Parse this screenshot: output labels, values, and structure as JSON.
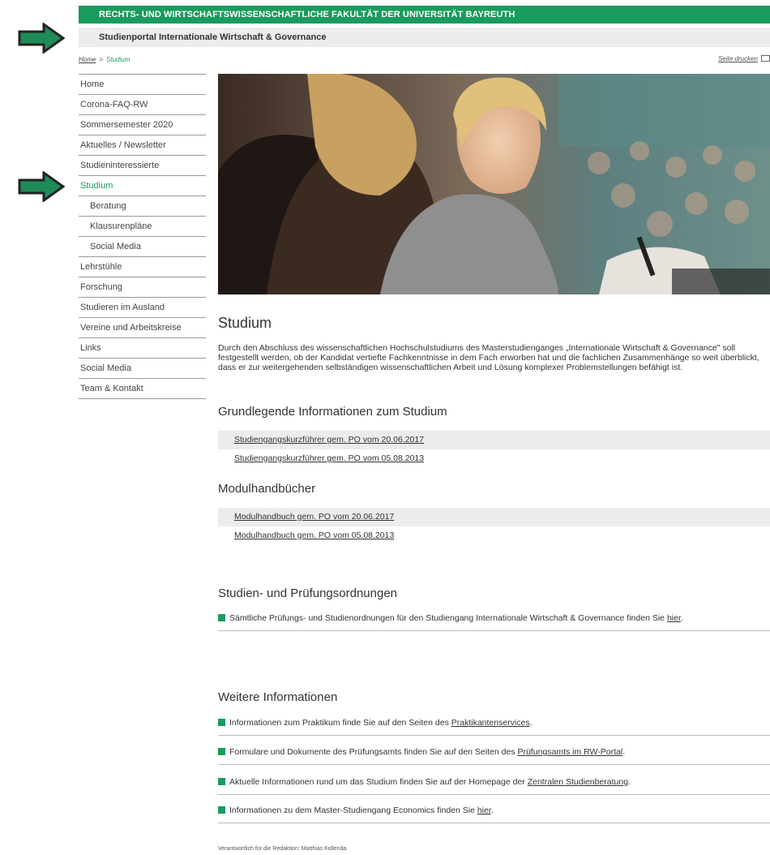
{
  "header": {
    "faculty": "RECHTS- UND WIRTSCHAFTSWISSENSCHAFTLICHE FAKULTÄT DER UNIVERSITÄT BAYREUTH",
    "portal": "Studienportal Internationale Wirtschaft & Governance"
  },
  "breadcrumb": {
    "home": "Home",
    "sep": ">",
    "current": "Studium"
  },
  "print_label": "Seite drucken",
  "sidebar": {
    "items": [
      {
        "label": "Home"
      },
      {
        "label": "Corona-FAQ-RW"
      },
      {
        "label": "Sommersemester 2020"
      },
      {
        "label": "Aktuelles / Newsletter"
      },
      {
        "label": "Studieninteressierte"
      },
      {
        "label": "Studium"
      },
      {
        "label": "Beratung"
      },
      {
        "label": "Klausurenpläne"
      },
      {
        "label": "Social Media"
      },
      {
        "label": "Lehrstühle"
      },
      {
        "label": "Forschung"
      },
      {
        "label": "Studieren im Ausland"
      },
      {
        "label": "Vereine und Arbeitskreise"
      },
      {
        "label": "Links"
      },
      {
        "label": "Social Media"
      },
      {
        "label": "Team & Kontakt"
      }
    ]
  },
  "main": {
    "title": "Studium",
    "intro": "Durch den Abschluss des wissenschaftlichen Hochschulstudiums des Masterstudienganges „Internationale Wirtschaft & Governance\" soll festgestellt werden, ob der Kandidat vertiefte Fachkenntnisse in dem Fach erworben hat und die fachlichen Zusammenhänge so weit überblickt, dass er zur weitergehenden selbständigen wissenschaftlichen Arbeit und Lösung komplexer Problemstellungen befähigt ist.",
    "section1": {
      "heading": "Grundlegende Informationen zum Studium",
      "docs": [
        "Studiengangskurzführer gem. PO vom 20.06.2017",
        "Studiengangskurzführer gem. PO vom 05.08.2013"
      ]
    },
    "section2": {
      "heading": "Modulhandbücher",
      "docs": [
        "Modulhandbuch gem. PO vom 20.06.2017",
        "Modulhandbuch gem. PO vom 05.08.2013"
      ]
    },
    "section3": {
      "heading": "Studien- und Prüfungsordnungen",
      "bullet_text": "Sämtliche Prüfungs- und Studienordnungen für den Studiengang Internationale Wirtschaft & Governance finden Sie ",
      "bullet_link": "hier",
      "bullet_end": "."
    },
    "section4": {
      "heading": "Weitere Informationen",
      "b1_text": "Informationen zum Praktikum finde Sie auf den Seiten des ",
      "b1_link": "Praktikantenservices",
      "b1_end": ".",
      "b2_text": "Formulare und Dokumente des Prüfungsamts finden Sie auf den Seiten des ",
      "b2_link": "Prüfungsamts im RW-Portal",
      "b2_end": ".",
      "b3_text": "Aktuelle Informationen rund um das Studium finden Sie auf der Homepage der ",
      "b3_link": "Zentralen Studienberatung",
      "b3_end": ".",
      "b4_text": "Informationen zu dem Master-Studiengang Economics finden Sie ",
      "b4_link": "hier",
      "b4_end": "."
    }
  },
  "footer": "Verantwortlich für die Redaktion: Matthias Kollenda",
  "colors": {
    "accent": "#1a9b5e",
    "arrow": "#1e8c57",
    "subbar": "#ececec"
  },
  "icons": {
    "arrows": "arrow-right-icon",
    "print": "printer-icon"
  }
}
